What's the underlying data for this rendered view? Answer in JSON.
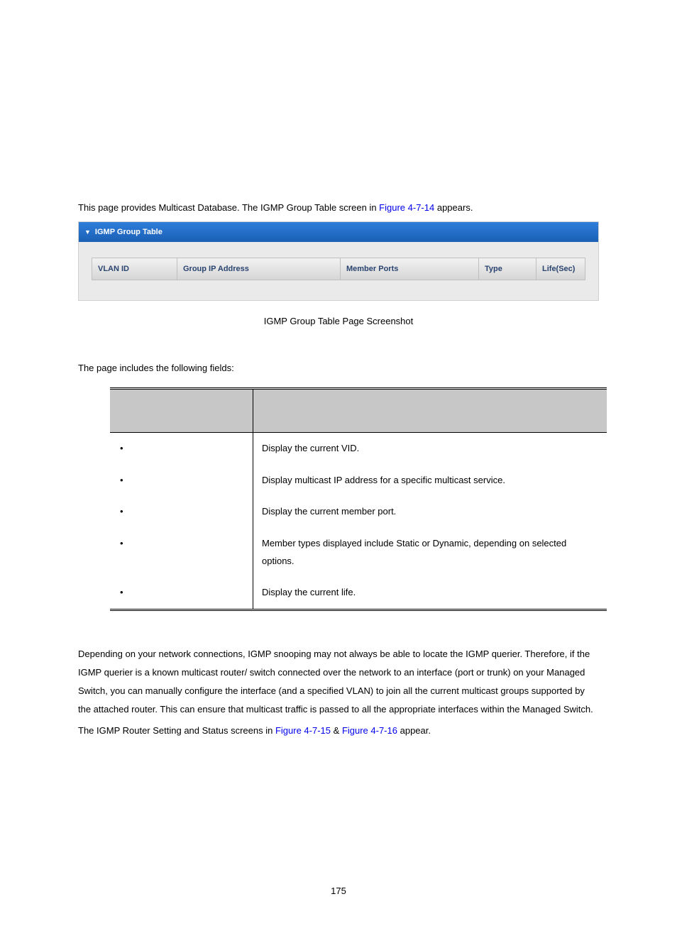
{
  "intro": {
    "prefix": "This page provides Multicast Database. The IGMP Group Table screen in ",
    "figlink": "Figure 4-7-14",
    "suffix": " appears."
  },
  "panel": {
    "title": "IGMP Group Table",
    "cols": {
      "vlan": "VLAN ID",
      "ip": "Group IP Address",
      "member": "Member Ports",
      "type": "Type",
      "life": "Life(Sec)"
    }
  },
  "caption": "IGMP Group Table Page Screenshot",
  "fields_intro": "The page includes the following fields:",
  "rows": [
    {
      "desc": "Display the current VID."
    },
    {
      "desc": "Display multicast IP address for a specific multicast service."
    },
    {
      "desc": "Display the current member port."
    },
    {
      "desc": "Member types displayed include Static or Dynamic, depending on selected options."
    },
    {
      "desc": "Display the current life."
    }
  ],
  "para1": "Depending on your network connections, IGMP snooping may not always be able to locate the IGMP querier. Therefore, if the IGMP querier is a known multicast router/ switch connected over the network to an interface (port or trunk) on your Managed Switch, you can manually configure the interface (and a specified VLAN) to join all the current multicast groups supported by the attached router. This can ensure that multicast traffic is passed to all the appropriate interfaces within the Managed Switch.",
  "para2": {
    "prefix": "The IGMP Router Setting and Status screens in ",
    "link1": "Figure 4-7-15",
    "mid": " & ",
    "link2": "Figure 4-7-16",
    "suffix": " appear."
  },
  "pagenum": "175"
}
